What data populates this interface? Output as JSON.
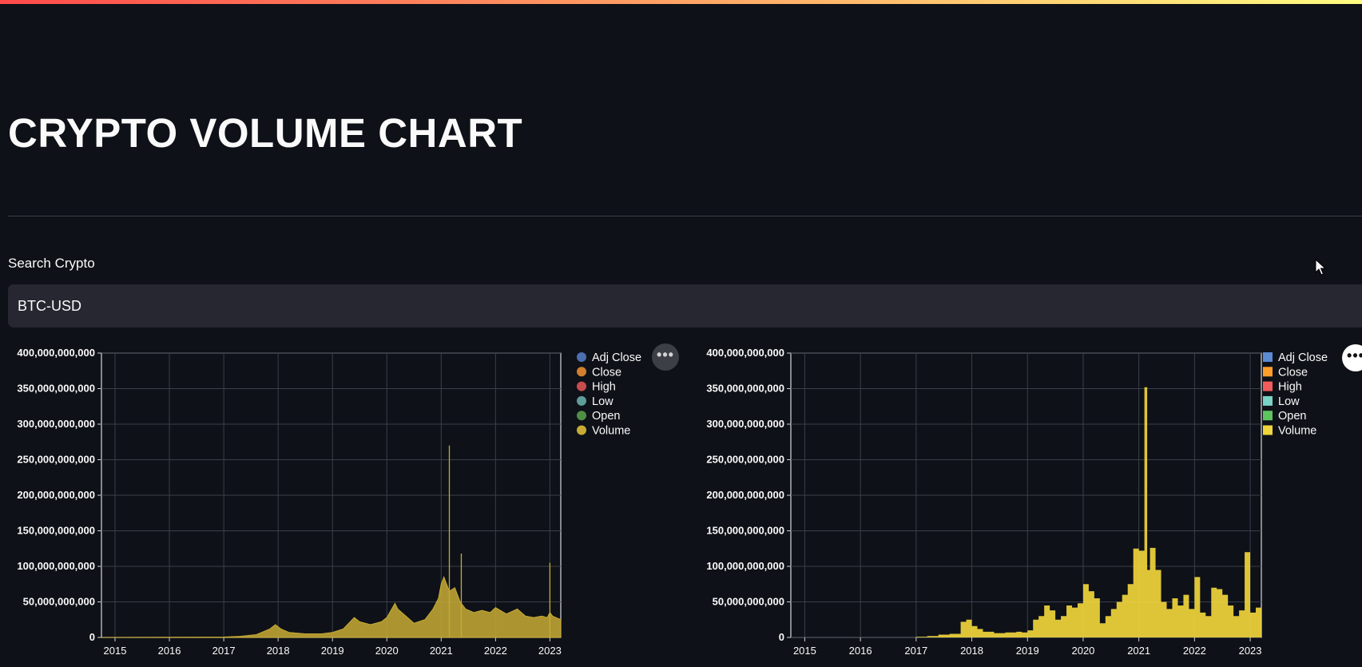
{
  "page": {
    "title": "CRYPTO VOLUME CHART"
  },
  "search": {
    "label": "Search Crypto",
    "value": "BTC-USD"
  },
  "icons": {
    "menu": "more-horizontal-icon",
    "cursor": "mouse-pointer-icon"
  },
  "colors": {
    "background": "#0e1117",
    "accent_gradient": [
      "#ff4b4b",
      "#fffd80"
    ]
  },
  "chart_data": [
    {
      "type": "area",
      "y_ticks": [
        "400,000,000,000",
        "350,000,000,000",
        "300,000,000,000",
        "250,000,000,000",
        "200,000,000,000",
        "150,000,000,000",
        "100,000,000,000",
        "50,000,000,000",
        "0"
      ],
      "x_ticks": [
        "2015",
        "2016",
        "2017",
        "2018",
        "2019",
        "2020",
        "2021",
        "2022",
        "2023"
      ],
      "ylim": [
        0,
        400000000000
      ],
      "xlim": [
        2014.75,
        2023.2
      ],
      "legend": {
        "placement": "right",
        "marker": "circle"
      },
      "grid": true,
      "series": [
        {
          "name": "Adj Close",
          "color": "#4c6fb0",
          "values": []
        },
        {
          "name": "Close",
          "color": "#d17f2f",
          "values": []
        },
        {
          "name": "High",
          "color": "#c94c4c",
          "values": []
        },
        {
          "name": "Low",
          "color": "#5e9d9a",
          "values": []
        },
        {
          "name": "Open",
          "color": "#4f8f44",
          "values": []
        },
        {
          "name": "Volume",
          "color": "#c8ab35",
          "x": [
            2014.75,
            2017.0,
            2017.3,
            2017.6,
            2017.85,
            2017.95,
            2018.05,
            2018.2,
            2018.5,
            2018.8,
            2019.0,
            2019.2,
            2019.4,
            2019.5,
            2019.7,
            2019.9,
            2020.0,
            2020.15,
            2020.2,
            2020.35,
            2020.5,
            2020.7,
            2020.85,
            2020.95,
            2021.0,
            2021.05,
            2021.15,
            2021.25,
            2021.35,
            2021.45,
            2021.6,
            2021.75,
            2021.9,
            2022.0,
            2022.2,
            2022.4,
            2022.55,
            2022.7,
            2022.85,
            2022.95,
            2023.0,
            2023.05,
            2023.2
          ],
          "values": [
            0,
            500000000,
            1500000000,
            4000000000,
            12000000000,
            18000000000,
            12000000000,
            7000000000,
            5000000000,
            5000000000,
            7000000000,
            12000000000,
            28000000000,
            22000000000,
            18000000000,
            22000000000,
            28000000000,
            48000000000,
            40000000000,
            30000000000,
            20000000000,
            25000000000,
            40000000000,
            55000000000,
            75000000000,
            85000000000,
            65000000000,
            70000000000,
            50000000000,
            40000000000,
            35000000000,
            38000000000,
            35000000000,
            42000000000,
            33000000000,
            40000000000,
            30000000000,
            28000000000,
            30000000000,
            28000000000,
            35000000000,
            30000000000,
            25000000000
          ],
          "spikes": [
            [
              2021.15,
              270000000000
            ],
            [
              2021.37,
              118000000000
            ],
            [
              2023.0,
              105000000000
            ]
          ]
        }
      ]
    },
    {
      "type": "bar",
      "y_ticks": [
        "400,000,000,000",
        "350,000,000,000",
        "300,000,000,000",
        "250,000,000,000",
        "200,000,000,000",
        "150,000,000,000",
        "100,000,000,000",
        "50,000,000,000",
        "0"
      ],
      "x_ticks": [
        "2015",
        "2016",
        "2017",
        "2018",
        "2019",
        "2020",
        "2021",
        "2022",
        "2023"
      ],
      "ylim": [
        0,
        400000000000
      ],
      "xlim": [
        2014.75,
        2023.2
      ],
      "legend": {
        "placement": "right",
        "marker": "square"
      },
      "grid": true,
      "series": [
        {
          "name": "Adj Close",
          "color": "#5b8bd0",
          "values": []
        },
        {
          "name": "Close",
          "color": "#ff9f2b",
          "values": []
        },
        {
          "name": "High",
          "color": "#f25c5c",
          "values": []
        },
        {
          "name": "Low",
          "color": "#79d3c7",
          "values": []
        },
        {
          "name": "Open",
          "color": "#5fc45f",
          "values": []
        },
        {
          "name": "Volume",
          "color": "#f0d53c",
          "x": [
            2014.75,
            2017.0,
            2017.2,
            2017.4,
            2017.6,
            2017.8,
            2017.9,
            2018.0,
            2018.1,
            2018.2,
            2018.4,
            2018.6,
            2018.8,
            2018.9,
            2019.0,
            2019.1,
            2019.2,
            2019.3,
            2019.4,
            2019.5,
            2019.6,
            2019.7,
            2019.8,
            2019.9,
            2020.0,
            2020.1,
            2020.2,
            2020.3,
            2020.4,
            2020.5,
            2020.6,
            2020.7,
            2020.8,
            2020.9,
            2021.0,
            2021.1,
            2021.15,
            2021.2,
            2021.3,
            2021.4,
            2021.5,
            2021.6,
            2021.7,
            2021.8,
            2021.9,
            2022.0,
            2022.1,
            2022.2,
            2022.3,
            2022.4,
            2022.5,
            2022.6,
            2022.7,
            2022.8,
            2022.9,
            2023.0,
            2023.1,
            2023.2
          ],
          "values": [
            0,
            1000000000,
            2000000000,
            4000000000,
            5000000000,
            22000000000,
            25000000000,
            16000000000,
            12000000000,
            8000000000,
            6000000000,
            7000000000,
            8000000000,
            7000000000,
            10000000000,
            25000000000,
            30000000000,
            45000000000,
            38000000000,
            25000000000,
            30000000000,
            45000000000,
            42000000000,
            48000000000,
            75000000000,
            65000000000,
            55000000000,
            20000000000,
            30000000000,
            40000000000,
            50000000000,
            60000000000,
            75000000000,
            125000000000,
            122000000000,
            352000000000,
            95000000000,
            126000000000,
            95000000000,
            50000000000,
            40000000000,
            55000000000,
            45000000000,
            60000000000,
            40000000000,
            85000000000,
            35000000000,
            30000000000,
            70000000000,
            68000000000,
            60000000000,
            45000000000,
            30000000000,
            38000000000,
            120000000000,
            35000000000,
            42000000000,
            35000000000
          ]
        }
      ]
    }
  ]
}
